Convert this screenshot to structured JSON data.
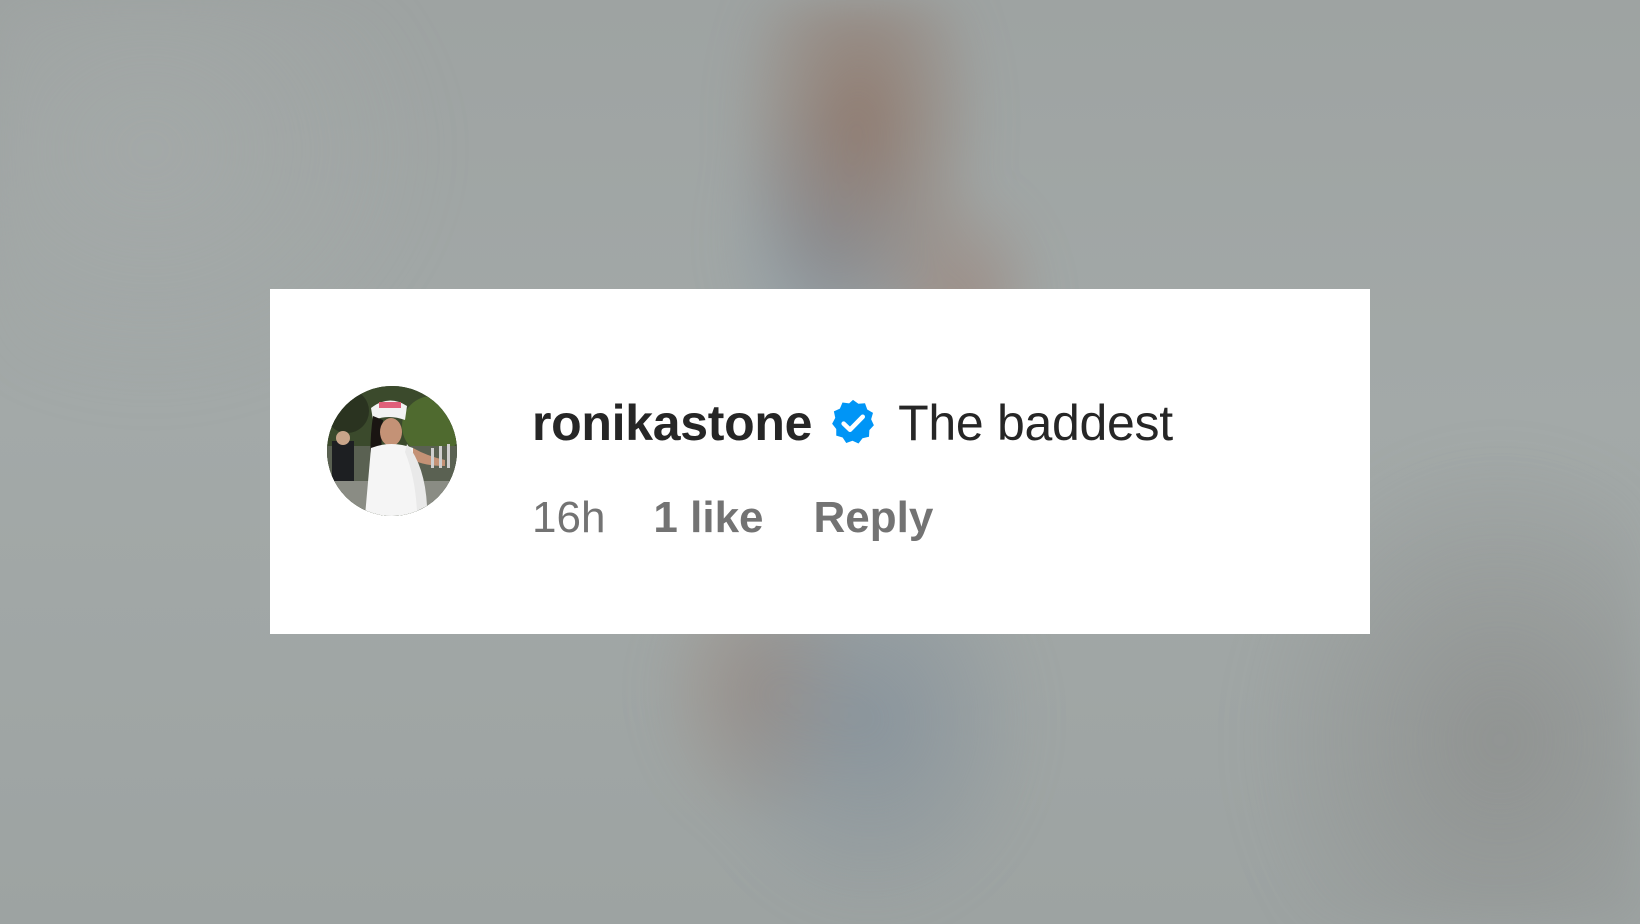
{
  "comment": {
    "username": "ronikastone",
    "verified_icon": "verified-badge-icon",
    "text": "The baddest",
    "timestamp": "16h",
    "likes_label": "1 like",
    "reply_label": "Reply"
  },
  "colors": {
    "card_background": "#ffffff",
    "primary_text": "#262626",
    "secondary_text": "#737373",
    "verified_blue": "#0095f6"
  }
}
